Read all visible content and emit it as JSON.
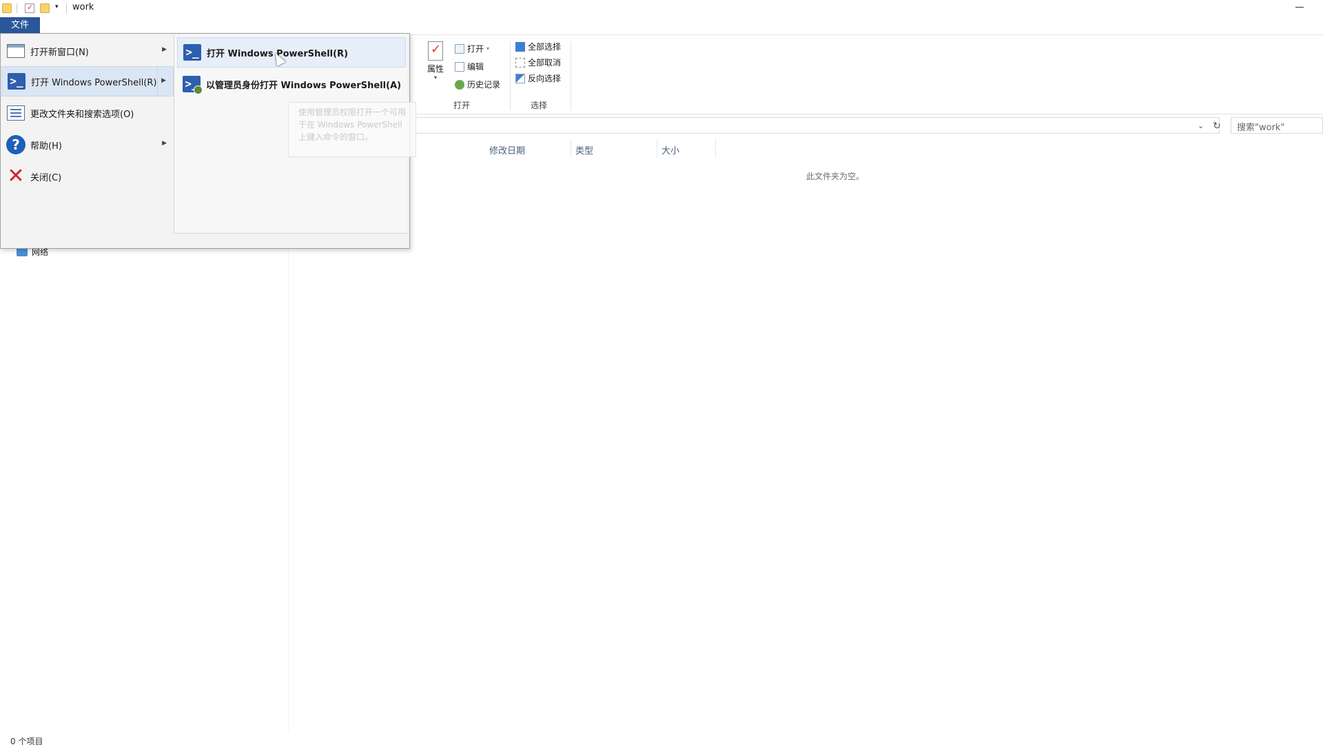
{
  "window": {
    "title": "work"
  },
  "ribbon": {
    "open_group": {
      "properties_label": "属性",
      "open_label": "打开",
      "edit_label": "编辑",
      "history_label": "历史记录",
      "group_label": "打开"
    },
    "select_group": {
      "select_all_label": "全部选择",
      "select_none_label": "全部取消",
      "invert_label": "反向选择",
      "group_label": "选择"
    }
  },
  "search": {
    "placeholder": "搜索\"work\""
  },
  "columns": {
    "modified": "修改日期",
    "type": "类型",
    "size": "大小"
  },
  "content": {
    "empty_message": "此文件夹为空。"
  },
  "nav": {
    "network_label": "网络"
  },
  "status": {
    "item_count": "0 个项目"
  },
  "file_menu": {
    "tab_label": "文件",
    "items": [
      {
        "label": "打开新窗口(N)",
        "icon": "new-window-icon"
      },
      {
        "label": "打开 Windows PowerShell(R)",
        "icon": "powershell-icon"
      },
      {
        "label": "更改文件夹和搜索选项(O)",
        "icon": "folder-options-icon"
      },
      {
        "label": "帮助(H)",
        "icon": "help-icon"
      },
      {
        "label": "关闭(C)",
        "icon": "close-icon"
      }
    ],
    "submenu": [
      {
        "label": "打开 Windows PowerShell(R)",
        "icon": "powershell-icon"
      },
      {
        "label": "以管理员身份打开 Windows PowerShell(A)",
        "icon": "powershell-admin-icon"
      }
    ],
    "tooltip": "使用管理员权限打开一个可用于在 Windows PowerShell 上键入命令的窗口。"
  },
  "colors": {
    "accent": "#2b579a",
    "powershell": "#2c5fae",
    "close_red": "#d4222a"
  }
}
